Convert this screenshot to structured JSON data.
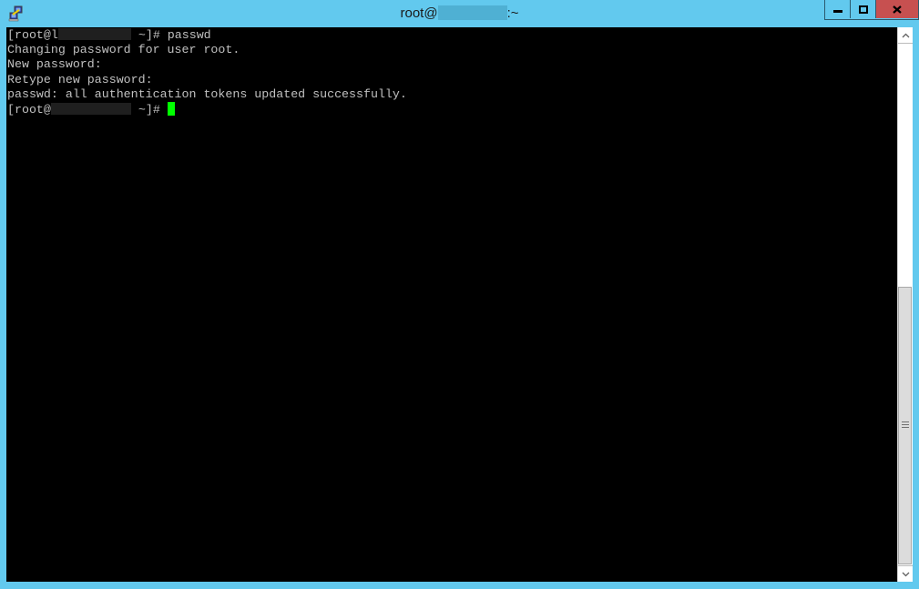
{
  "window": {
    "title_prefix": "root@",
    "title_suffix": ":~",
    "icon": "putty-icon",
    "controls": {
      "minimize": "minimize-icon",
      "maximize": "maximize-icon",
      "close": "close-icon"
    },
    "colors": {
      "frame": "#62c9ee",
      "close": "#c75050",
      "terminal_bg": "#000000",
      "terminal_fg": "#c0c0c0",
      "cursor": "#00ff00"
    }
  },
  "terminal": {
    "lines": [
      {
        "prefix": "[root@",
        "redacted_lead": "l",
        "suffix": " ~]# passwd"
      },
      {
        "text": "Changing password for user root."
      },
      {
        "text": "New password:"
      },
      {
        "text": "Retype new password:"
      },
      {
        "text": "passwd: all authentication tokens updated successfully."
      },
      {
        "prefix": "[root@",
        "suffix": " ~]# "
      }
    ]
  },
  "scrollbar": {
    "up": "chevron-up-icon",
    "down": "chevron-down-icon",
    "position": 1.0
  }
}
